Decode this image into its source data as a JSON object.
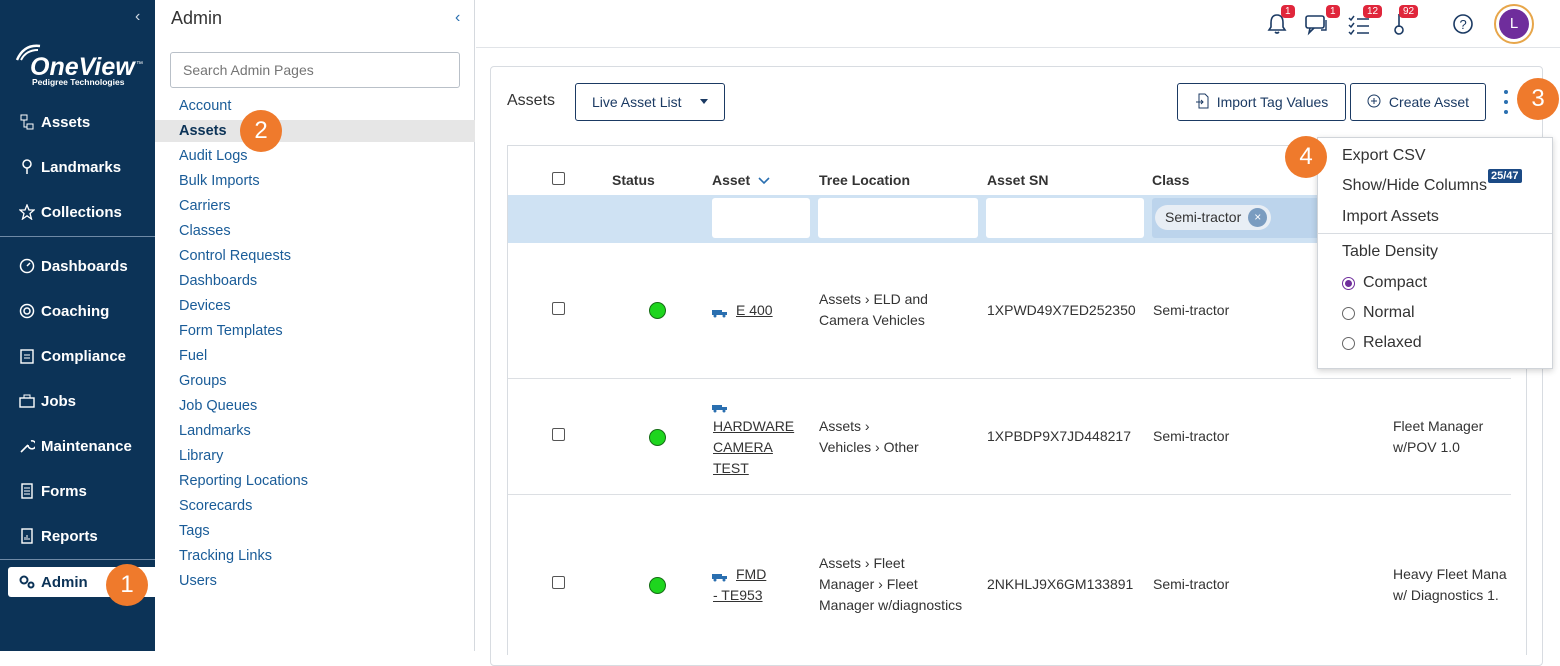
{
  "nav": {
    "logo_text": "OneView",
    "logo_tm": "™",
    "logo_sub": "Pedigree Technologies",
    "items": [
      {
        "label": "Assets",
        "icon": "sitemap-icon"
      },
      {
        "label": "Landmarks",
        "icon": "map-pin-icon"
      },
      {
        "label": "Collections",
        "icon": "star-icon"
      },
      {
        "label": "Dashboards",
        "icon": "gauge-icon"
      },
      {
        "label": "Coaching",
        "icon": "target-icon"
      },
      {
        "label": "Compliance",
        "icon": "clipboard-icon"
      },
      {
        "label": "Jobs",
        "icon": "briefcase-icon"
      },
      {
        "label": "Maintenance",
        "icon": "wrench-icon"
      },
      {
        "label": "Forms",
        "icon": "document-icon"
      },
      {
        "label": "Reports",
        "icon": "report-icon"
      },
      {
        "label": "Admin",
        "icon": "gears-icon"
      }
    ]
  },
  "admin": {
    "title": "Admin",
    "search_placeholder": "Search Admin Pages",
    "links": [
      "Account",
      "Assets",
      "Audit Logs",
      "Bulk Imports",
      "Carriers",
      "Classes",
      "Control Requests",
      "Dashboards",
      "Devices",
      "Form Templates",
      "Fuel",
      "Groups",
      "Job Queues",
      "Landmarks",
      "Library",
      "Reporting Locations",
      "Scorecards",
      "Tags",
      "Tracking Links",
      "Users"
    ]
  },
  "topbar": {
    "notifications_badge": "1",
    "messages_badge": "1",
    "tasks_badge": "12",
    "alerts_badge": "92",
    "avatar_initial": "L"
  },
  "assets_page": {
    "title": "Assets",
    "view_select": "Live Asset List",
    "import_tag_values": "Import Tag Values",
    "create_asset": "Create Asset"
  },
  "table": {
    "headers": [
      "Status",
      "Asset",
      "Tree Location",
      "Asset SN",
      "Class"
    ],
    "class_filter_chip": "Semi-tractor",
    "rows": [
      {
        "asset": "E 400",
        "tree_line1": "Assets › ELD and",
        "tree_line2": "Camera Vehicles",
        "tree_line3": "",
        "sn": "1XPWD49X7ED252350",
        "class": "Semi-tractor",
        "extra_line1": "",
        "extra_line2": ""
      },
      {
        "asset_line1": "HARDWARE",
        "asset_line2": "CAMERA",
        "asset_line3": "TEST",
        "tree_line1": "Assets ›",
        "tree_line2": "Vehicles › Other",
        "tree_line3": "",
        "sn": "1XPBDP9X7JD448217",
        "class": "Semi-tractor",
        "extra_line1": "Fleet Manager",
        "extra_line2": "w/POV 1.0"
      },
      {
        "asset_line1": "FMD",
        "asset_line2": "- TE953",
        "tree_line1": "Assets › Fleet",
        "tree_line2": "Manager › Fleet",
        "tree_line3": "Manager w/diagnostics",
        "sn": "2NKHLJ9X6GM133891",
        "class": "Semi-tractor",
        "extra_line1": "Heavy Fleet Mana",
        "extra_line2": "w/ Diagnostics 1."
      }
    ]
  },
  "menu": {
    "export_csv": "Export CSV",
    "show_hide_columns": "Show/Hide Columns",
    "columns_badge": "25/47",
    "import_assets": "Import Assets",
    "table_density": "Table Density",
    "density_options": [
      "Compact",
      "Normal",
      "Relaxed"
    ],
    "selected_density": "Compact"
  },
  "callouts": [
    "1",
    "2",
    "3",
    "4"
  ],
  "colors": {
    "nav_bg": "#0c3357",
    "link": "#1a5c98",
    "callout": "#ef7a2c",
    "status_ok": "#1ed51e",
    "badge": "#e0263b"
  }
}
